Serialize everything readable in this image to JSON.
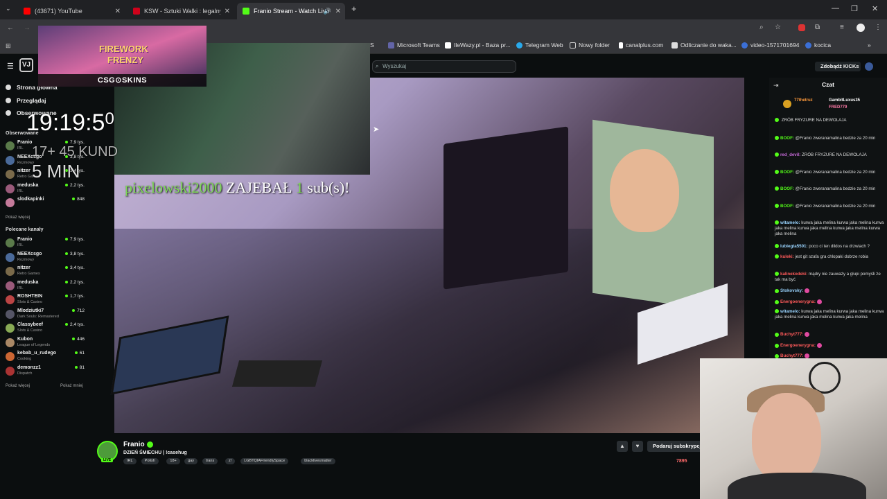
{
  "browser": {
    "tabs": [
      {
        "label": "(43671) YouTube",
        "color": "#ff0000",
        "active": false
      },
      {
        "label": "KSW - Sztuki Walki : legalny buk",
        "color": "#d0021b",
        "active": false
      },
      {
        "label": "Franio Stream - Watch Live",
        "color": "#53fc18",
        "active": true
      }
    ],
    "bookmarks": [
      "Microsoft Teams",
      "IleWazy.pl - Baza pr...",
      "Telegram Web",
      "Nowy folder",
      "canalplus.com",
      "Odliczanie do waka...",
      "video-1571701694",
      "kocica"
    ],
    "bookmark_partial": "S"
  },
  "header": {
    "search_placeholder": "Wyszukaj",
    "get_kicks": "Zdobądź KICKs"
  },
  "sidebar": {
    "nav": [
      "Strona główna",
      "Przeglądaj",
      "Obserwowane"
    ],
    "followed_title": "Obserwowane",
    "followed": [
      {
        "name": "Franio",
        "cat": "IRL",
        "viewers": "7,9 tys.",
        "color": "#5a7a4a"
      },
      {
        "name": "NEEXcsgo",
        "cat": "Rozmowy",
        "viewers": "3,8 tys.",
        "color": "#4a6a9a"
      },
      {
        "name": "nitzer",
        "cat": "Retro Games",
        "viewers": "3,4 tys.",
        "color": "#7a6a4a"
      },
      {
        "name": "meduska",
        "cat": "IRL",
        "viewers": "2,2 tys.",
        "color": "#9a5a7a"
      },
      {
        "name": "slodkapinki",
        "cat": "",
        "viewers": "848",
        "color": "#c47a9a"
      }
    ],
    "followed_more": "Pokaż więcej",
    "recommended_title": "Polecane kanały",
    "recommended": [
      {
        "name": "Franio",
        "cat": "IRL",
        "viewers": "7,9 tys.",
        "color": "#5a7a4a"
      },
      {
        "name": "NEEXcsgo",
        "cat": "Rozmowy",
        "viewers": "3,8 tys.",
        "color": "#4a6a9a"
      },
      {
        "name": "nitzer",
        "cat": "Retro Games",
        "viewers": "3,4 tys.",
        "color": "#7a6a4a"
      },
      {
        "name": "meduska",
        "cat": "IRL",
        "viewers": "2,2 tys.",
        "color": "#9a5a7a"
      },
      {
        "name": "ROSHTEIN",
        "cat": "Slots & Casino",
        "viewers": "1,7 tys.",
        "color": "#b44"
      },
      {
        "name": "Mlodziutki7",
        "cat": "Dark Souls: Remastered",
        "viewers": "712",
        "color": "#556"
      },
      {
        "name": "Classybeef",
        "cat": "Slots & Casino",
        "viewers": "2,4 tys.",
        "color": "#8a5"
      },
      {
        "name": "Kubon",
        "cat": "League of Legends",
        "viewers": "446",
        "color": "#a86"
      },
      {
        "name": "kebab_u_rudego",
        "cat": "Cooking",
        "viewers": "61",
        "color": "#c63"
      },
      {
        "name": "demonzz1",
        "cat": "Dispatch",
        "viewers": "81",
        "color": "#a33"
      }
    ],
    "rec_more": "Pokaż więcej",
    "rec_less": "Pokaż mniej"
  },
  "overlay": {
    "game_ad_title1": "FIREWORK",
    "game_ad_title2": "FRENZY",
    "sponsor": "CSG⊙SKINS",
    "timer": "19:19:5",
    "timer_digit": "0",
    "timer_line2": "17+ 45 KUND",
    "timer_line3": "5 MIN",
    "sub_user": "pixelowski2000",
    "sub_word": "ZAJEBAŁ",
    "sub_count": "1",
    "sub_suffix": "sub(s)!"
  },
  "stream": {
    "streamer": "Franio",
    "title": "DZIEŃ ŚMIECHU | !casehug",
    "live_label": "LIVE",
    "tags": [
      "IRL",
      "Polish",
      "18+",
      "gay",
      "trans",
      "z!",
      "LGBTQIAFriendlySpace",
      "blacklivesmatter"
    ],
    "subscribe": "Podaruj subskrypcję",
    "viewers": "7895"
  },
  "chat": {
    "header": "Czat",
    "pinned": [
      {
        "user": "77thetruz",
        "color": "#ff9a3c"
      },
      {
        "user": "GambitLuxus35",
        "color": "#ffffff"
      },
      {
        "user": "FRED779",
        "color": "#ff7aa8"
      }
    ],
    "messages": [
      {
        "user": "",
        "text": "ZRÓB FRYZURE NA DEWOLAJA",
        "color": "#c66ad8"
      },
      {
        "user": "BOOF:",
        "text": "@Franio zweranamalina bedzie za 20 min",
        "color": "#53fc18"
      },
      {
        "user": "red_devil:",
        "text": "ZRÓB FRYZURE NA DEWOLAJA",
        "color": "#c66ad8"
      },
      {
        "user": "BOOF:",
        "text": "@Franio zweranamalina bedzie za 20 min",
        "color": "#53fc18"
      },
      {
        "user": "BOOF:",
        "text": "@Franio zweranamalina bedzie za 20 min",
        "color": "#53fc18"
      },
      {
        "user": "BOOF:",
        "text": "@Franio zweranamalina bedzie za 20 min",
        "color": "#53fc18"
      },
      {
        "user": "witamelo:",
        "text": "kurwa jaka melina kurwa jaka melina kurwa jaka melina kurwa jaka melina kurwa jaka melina kurwa jaka melina",
        "color": "#9ad4ff"
      },
      {
        "user": "lubiegta5501:",
        "text": "poco ci ten dildos na drzwiach ?",
        "color": "#9ad4ff"
      },
      {
        "user": "kuleki:",
        "text": "jest git szafa gra chlopaki dobrze robia",
        "color": "#ff5a5a"
      },
      {
        "user": "kalinekodeki:",
        "text": "mądry nie zauważy a głupi pomyśli że tak ma być",
        "color": "#ff5a5a"
      },
      {
        "user": "Stokovsky:",
        "text": "",
        "color": "#9ad4ff"
      },
      {
        "user": "Energoenerygna:",
        "text": "",
        "color": "#ff5a5a"
      },
      {
        "user": "witamelo:",
        "text": "kurwa jaka melina kurwa jaka melina kurwa jaka melina kurwa jaka melina kurwa jaka melina",
        "color": "#9ad4ff"
      },
      {
        "user": "Buchyt777:",
        "text": "",
        "color": "#ff5a5a"
      },
      {
        "user": "Energoenerygna:",
        "text": "",
        "color": "#ff5a5a"
      },
      {
        "user": "Buchyt777:",
        "text": "",
        "color": "#ff5a5a"
      }
    ]
  }
}
